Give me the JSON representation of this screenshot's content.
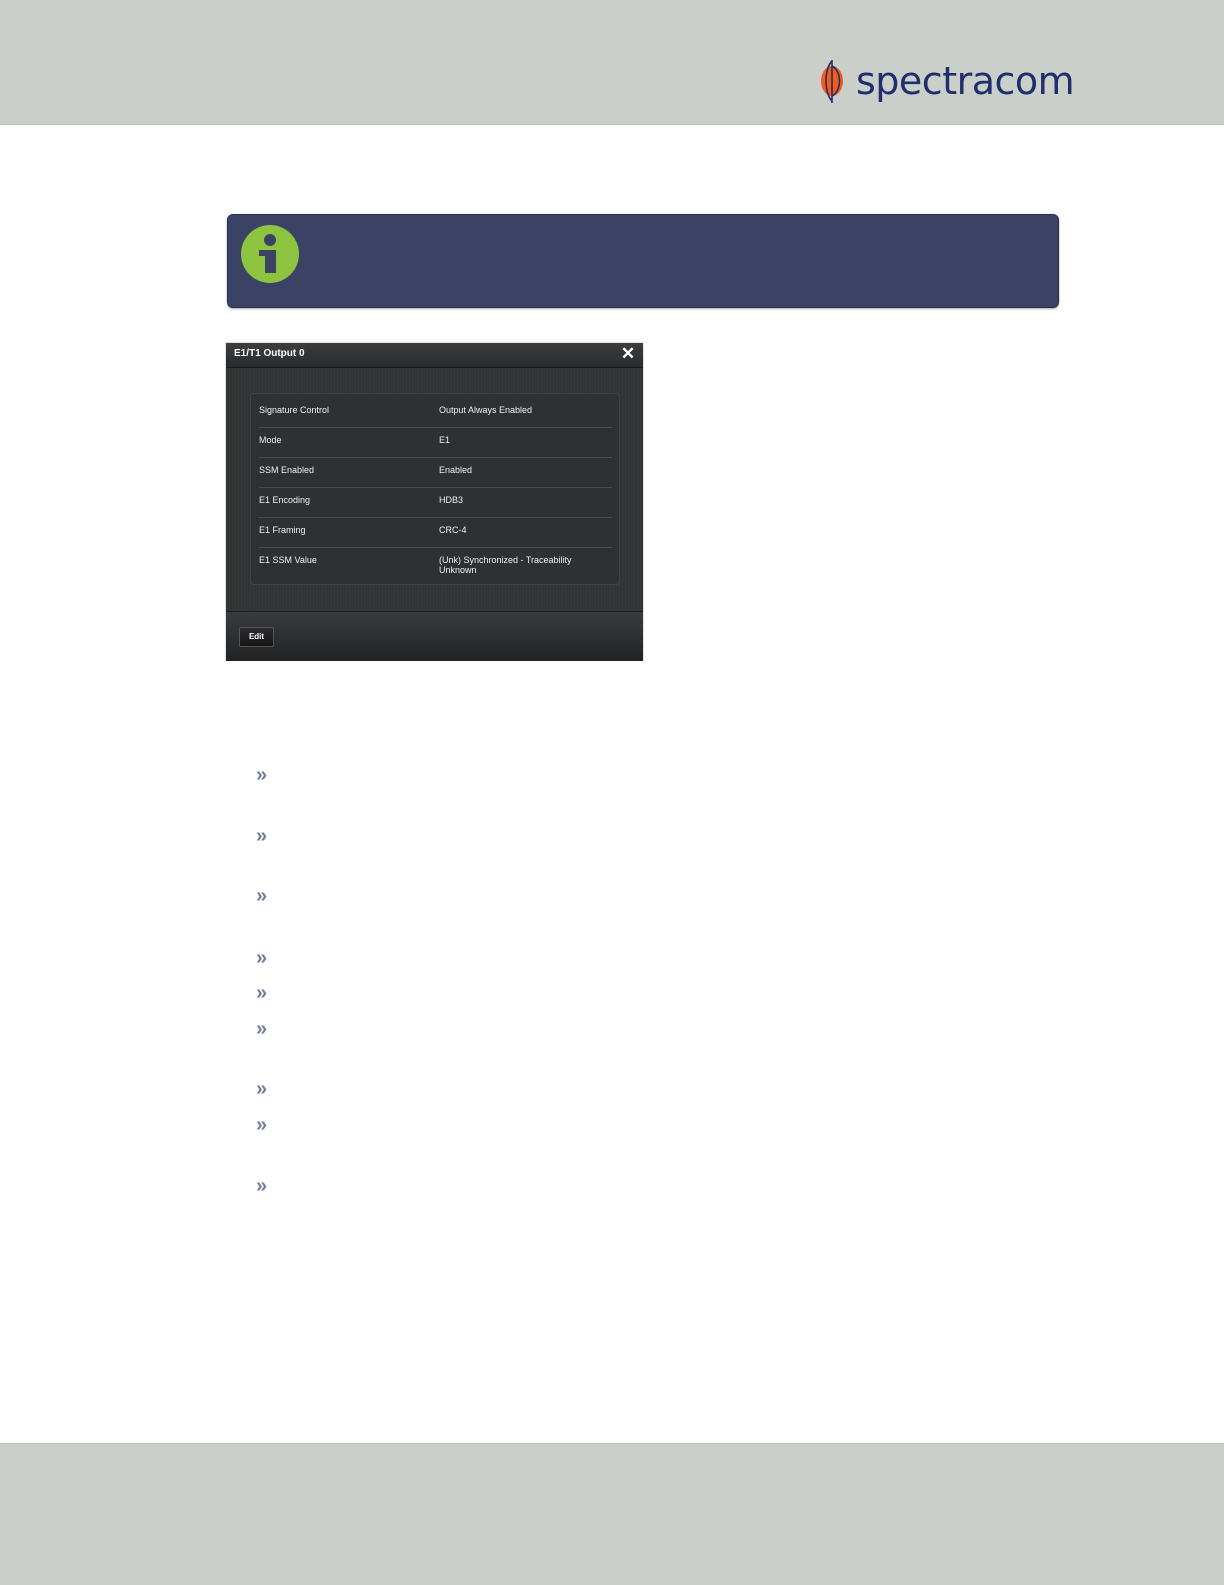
{
  "header": {
    "brand": "spectracom",
    "logo_icon": "spectracom-orb-logo"
  },
  "info_box": {
    "icon": "info-icon",
    "text": ""
  },
  "dialog": {
    "title": "E1/T1 Output 0",
    "close_icon": "close-icon",
    "properties": [
      {
        "label": "Signature Control",
        "value": "Output Always Enabled"
      },
      {
        "label": "Mode",
        "value": "E1"
      },
      {
        "label": "SSM Enabled",
        "value": "Enabled"
      },
      {
        "label": "E1 Encoding",
        "value": "HDB3"
      },
      {
        "label": "E1 Framing",
        "value": "CRC-4"
      },
      {
        "label": "E1 SSM Value",
        "value": "(Unk) Synchronized - Traceability Unknown"
      }
    ],
    "edit_label": "Edit"
  },
  "bullets": {
    "glyph": "»",
    "icon": "double-chevron-right-icon",
    "count": 9
  },
  "colors": {
    "header_bg": "#cacfca",
    "info_bg": "#3c4266",
    "info_icon": "#8cc43f",
    "brand_blue": "#1f2f6b",
    "brand_orange": "#f25c19",
    "bullet": "#6f7d9a"
  }
}
